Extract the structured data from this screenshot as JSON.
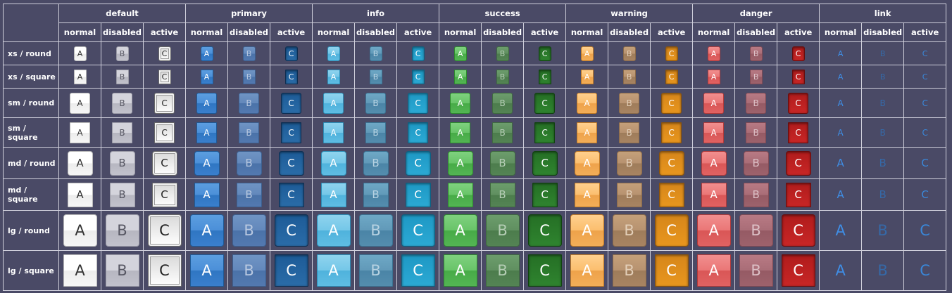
{
  "columns": {
    "groups": [
      {
        "key": "default",
        "label": "default"
      },
      {
        "key": "primary",
        "label": "primary"
      },
      {
        "key": "info",
        "label": "info"
      },
      {
        "key": "success",
        "label": "success"
      },
      {
        "key": "warning",
        "label": "warning"
      },
      {
        "key": "danger",
        "label": "danger"
      },
      {
        "key": "link",
        "label": "link"
      }
    ],
    "states": [
      {
        "key": "normal",
        "label": "normal",
        "button_text": "A"
      },
      {
        "key": "disabled",
        "label": "disabled",
        "button_text": "B"
      },
      {
        "key": "active",
        "label": "active",
        "button_text": "C"
      }
    ]
  },
  "rows": [
    {
      "label": "xs / round",
      "size": "xs",
      "shape": "round"
    },
    {
      "label": "xs / square",
      "size": "xs",
      "shape": "square"
    },
    {
      "label": "sm / round",
      "size": "sm",
      "shape": "round"
    },
    {
      "label": "sm / square",
      "size": "sm",
      "shape": "square"
    },
    {
      "label": "md / round",
      "size": "md",
      "shape": "round"
    },
    {
      "label": "md / square",
      "size": "md",
      "shape": "square"
    },
    {
      "label": "lg / round",
      "size": "lg",
      "shape": "round"
    },
    {
      "label": "lg / square",
      "size": "lg",
      "shape": "square"
    }
  ],
  "colors": {
    "background": "#4a4a66",
    "grid_line": "#d0d0dc",
    "default": "#ffffff",
    "primary": "#3a7fcd",
    "info": "#5fbde3",
    "success": "#53b553",
    "warning": "#f3ae58",
    "danger": "#e06262",
    "link": "#3f8ee6"
  }
}
